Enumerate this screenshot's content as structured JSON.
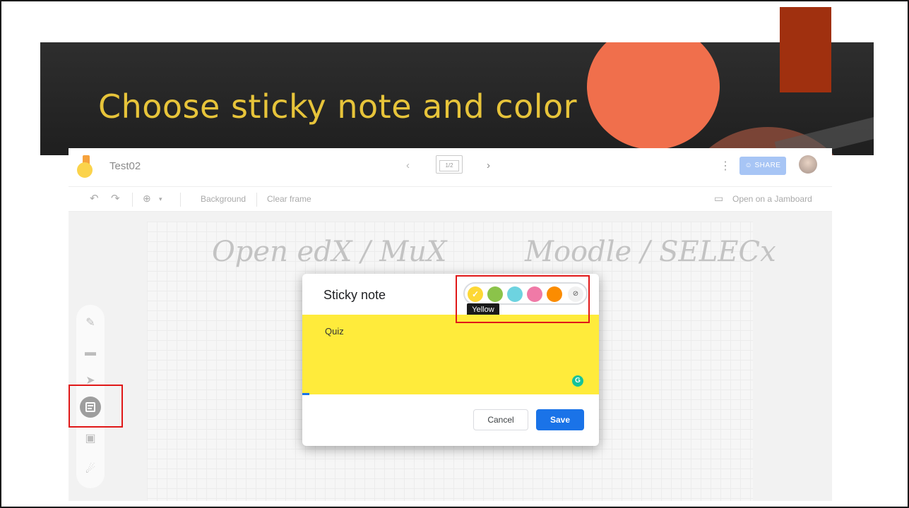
{
  "slide": {
    "title": "Choose sticky note and color",
    "colors": {
      "banner": "#252525",
      "title": "#e7c43a",
      "accent_orange": "#f06f4c",
      "accent_red": "#a0300f",
      "highlight": "#e01818"
    }
  },
  "app": {
    "doc_title": "Test02",
    "frame_indicator": "1/2",
    "share_label": "SHARE",
    "open_on_jamboard": "Open on a Jamboard",
    "toolbar": {
      "background_label": "Background",
      "clear_frame_label": "Clear frame"
    },
    "canvas_writing": {
      "left": "Open edX / MuX",
      "right": "Moodle / SELECx"
    },
    "side_tools": [
      "pen-icon",
      "eraser-icon",
      "select-icon",
      "sticky-note-icon",
      "image-icon",
      "laser-icon"
    ]
  },
  "dialog": {
    "title": "Sticky note",
    "swatches": [
      {
        "name": "Yellow",
        "color": "#fdd835",
        "selected": true
      },
      {
        "name": "Green",
        "color": "#8bc34a",
        "selected": false
      },
      {
        "name": "Blue",
        "color": "#6dd3e0",
        "selected": false
      },
      {
        "name": "Pink",
        "color": "#f07aa7",
        "selected": false
      },
      {
        "name": "Orange",
        "color": "#fb8c00",
        "selected": false
      }
    ],
    "tooltip": "Yellow",
    "note_text": "Quiz",
    "note_color": "#ffeb3b",
    "cancel_label": "Cancel",
    "save_label": "Save"
  }
}
